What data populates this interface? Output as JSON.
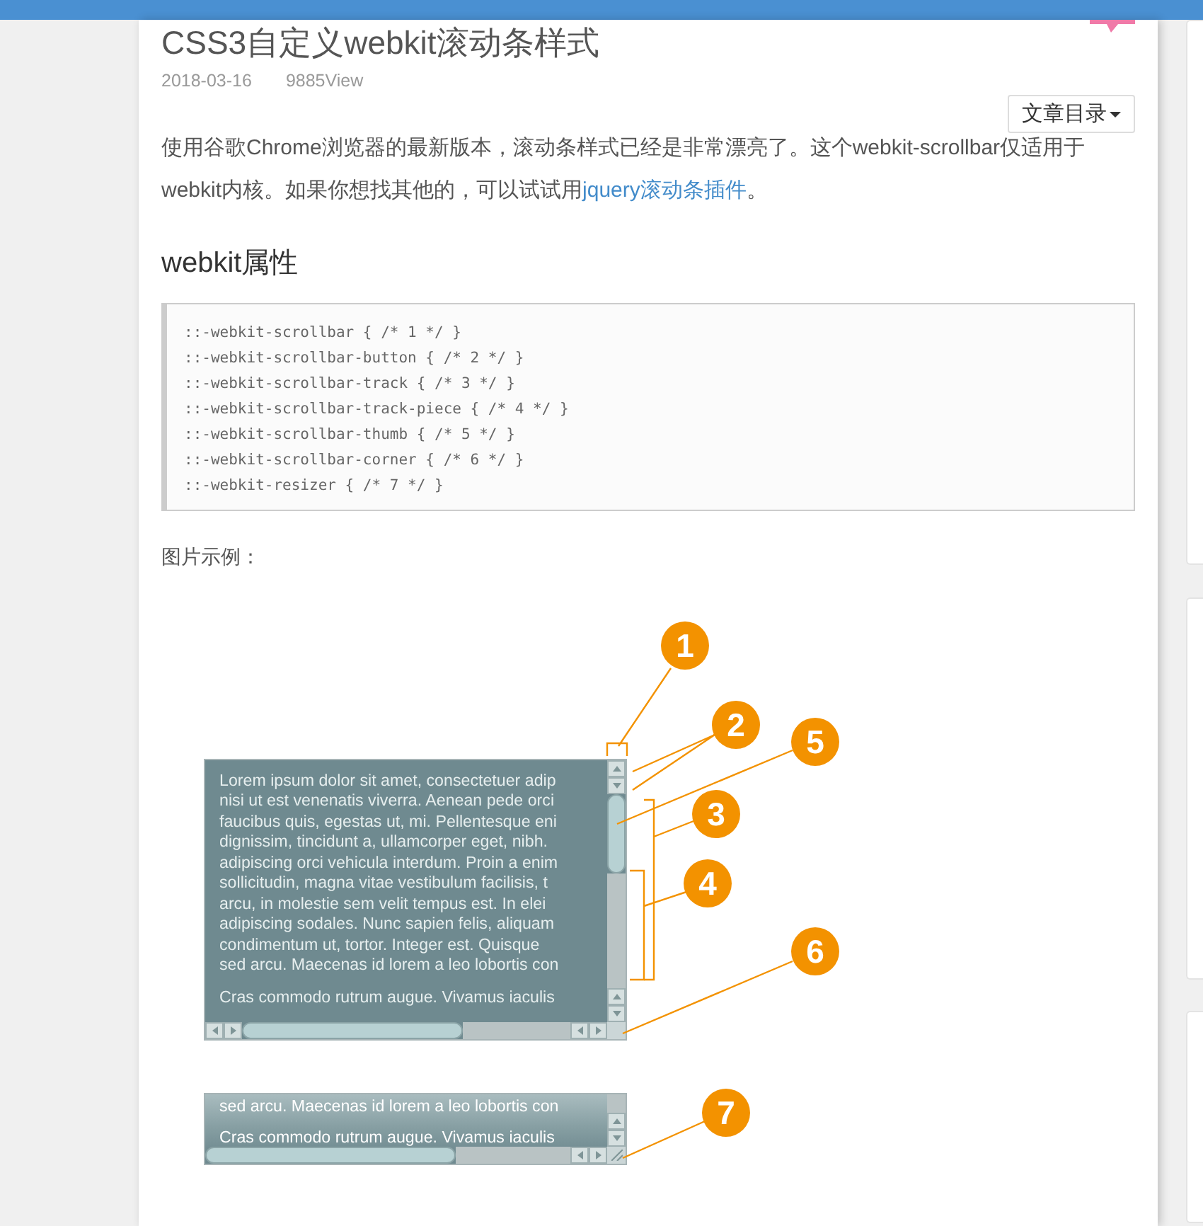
{
  "article": {
    "title": "CSS3自定义webkit滚动条样式",
    "date": "2018-03-16",
    "views": "9885View",
    "toc_button": "文章目录",
    "intro_before": "使用谷歌Chrome浏览器的最新版本，滚动条样式已经是非常漂亮了。这个webkit-scrollbar仅适用于webkit内核。如果你想找其他的，可以试试用",
    "intro_link": "jquery滚动条插件",
    "intro_after": "。",
    "heading": "webkit属性",
    "code_lines": [
      "::-webkit-scrollbar { /* 1 */ }",
      "::-webkit-scrollbar-button { /* 2 */ }",
      "::-webkit-scrollbar-track { /* 3 */ }",
      "::-webkit-scrollbar-track-piece { /* 4 */ }",
      "::-webkit-scrollbar-thumb { /* 5 */ }",
      "::-webkit-scrollbar-corner { /* 6 */ }",
      "::-webkit-resizer { /* 7 */ }"
    ],
    "caption": "图片示例：",
    "diagram": {
      "demo_paragraphs": [
        [
          "Lorem ipsum dolor sit amet, consectetuer adip",
          "nisi ut est venenatis viverra. Aenean pede orci",
          "faucibus quis, egestas ut, mi. Pellentesque eni",
          "dignissim, tincidunt a, ullamcorper eget, nibh.",
          "adipiscing orci vehicula interdum. Proin a enim",
          "sollicitudin, magna vitae vestibulum facilisis, t",
          "arcu, in molestie sem velit tempus est. In elei",
          "adipiscing sodales. Nunc sapien felis, aliquam",
          "condimentum ut, tortor. Integer est. Quisque",
          "sed arcu. Maecenas id lorem a leo lobortis con"
        ],
        [
          "Cras commodo rutrum augue. Vivamus iaculis"
        ]
      ],
      "resizer_paragraphs": [
        [
          "sed arcu. Maecenas id lorem a leo lobortis con"
        ],
        [
          "Cras commodo rutrum augue. Vivamus iaculis"
        ]
      ],
      "callouts": [
        "1",
        "2",
        "5",
        "3",
        "4",
        "6",
        "7"
      ]
    }
  }
}
